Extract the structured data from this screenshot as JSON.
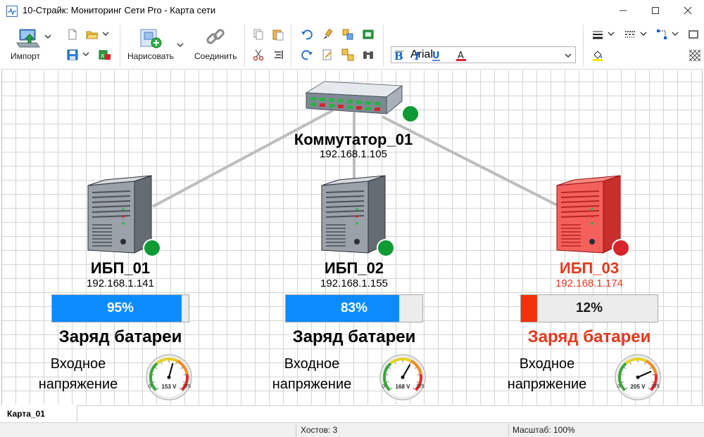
{
  "window": {
    "title": "10-Страйк: Мониторинг Сети Pro - Карта сети"
  },
  "toolbar": {
    "import_label": "Импорт",
    "draw_label": "Нарисовать",
    "connect_label": "Соединить",
    "font_name": "Arial",
    "font_size": "10",
    "text_color": "#0a74f0"
  },
  "devices": [
    {
      "name": "Коммутатор_01",
      "ip": "192.168.1.105",
      "status": "up"
    },
    {
      "name": "ИБП_01",
      "ip": "192.168.1.141",
      "status": "up",
      "charge": 95,
      "charge_text": "95%",
      "charge_label": "Заряд батареи",
      "voltage_label": "Входное\nнапряжение",
      "gauge": {
        "value": 153,
        "max": 275,
        "min_label": "0",
        "max_label": "275",
        "value_label": "153 V"
      }
    },
    {
      "name": "ИБП_02",
      "ip": "192.168.1.155",
      "status": "up",
      "charge": 83,
      "charge_text": "83%",
      "charge_label": "Заряд батареи",
      "voltage_label": "Входное\nнапряжение",
      "gauge": {
        "value": 168,
        "max": 275,
        "min_label": "0",
        "max_label": "275",
        "value_label": "168 V"
      }
    },
    {
      "name": "ИБП_03",
      "ip": "192.168.1.174",
      "status": "down",
      "charge": 12,
      "charge_text": "12%",
      "charge_label": "Заряд батареи",
      "voltage_label": "Входное\nнапряжение",
      "gauge": {
        "value": 205,
        "max": 275,
        "min_label": "0",
        "max_label": "275",
        "value_label": "205 V"
      }
    }
  ],
  "colors": {
    "ok": "#0f9a34",
    "alarm": "#d8242c",
    "alarm_text": "#e03a1e",
    "bar_ok": "#0a8cff",
    "bar_alarm": "#f03208",
    "link": "#bdbdbd"
  },
  "tabs": [
    {
      "label": "Карта_01"
    }
  ],
  "status": {
    "hosts": "Хостов: 3",
    "zoom": "Масштаб: 100%"
  }
}
